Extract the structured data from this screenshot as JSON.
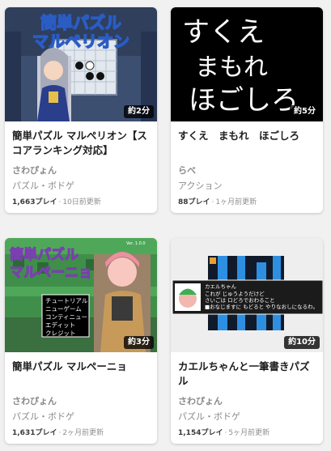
{
  "games": [
    {
      "thumb_title_line1": "簡単パズル",
      "thumb_title_line2": "マルペリオン",
      "duration": "約2分",
      "title": "簡単パズル マルペリオン【スコアランキング対応】",
      "author": "さわぴょん",
      "genre": "パズル・ボドゲ",
      "plays": "1,663プレイ",
      "updated": "10日前更新"
    },
    {
      "thumb_text_line1": "すくえ",
      "thumb_text_line2": "まもれ",
      "thumb_text_line3": "ほごしろ",
      "duration": "約5分",
      "title": "すくえ　まもれ　ほごしろ",
      "author": "らべ",
      "genre": "アクション",
      "plays": "88プレイ",
      "updated": "1ヶ月前更新"
    },
    {
      "thumb_title_line1": "簡単パズル",
      "thumb_title_line2": "マルペーニョ",
      "thumb_version": "Ver. 1.0.0",
      "thumb_menu": [
        "チュートリアル",
        "ニューゲーム",
        "コンティニュー",
        "エディット",
        "クレジット"
      ],
      "duration": "約3分",
      "title": "簡単パズル マルペーニョ",
      "author": "さわぴょん",
      "genre": "パズル・ボドゲ",
      "plays": "1,631プレイ",
      "updated": "2ヶ月前更新"
    },
    {
      "thumb_dialog_name": "カエルちゃん",
      "thumb_dialog_line1": "これが じゅうようだけど",
      "thumb_dialog_line2": "さいごは ロどろでおわること",
      "thumb_dialog_line3": "■おなじますに もどると やりなおしになるわ。",
      "duration": "約10分",
      "title": "カエルちゃんと一筆書きパズル",
      "author": "さわぴょん",
      "genre": "パズル・ボドゲ",
      "plays": "1,154プレイ",
      "updated": "5ヶ月前更新"
    }
  ]
}
